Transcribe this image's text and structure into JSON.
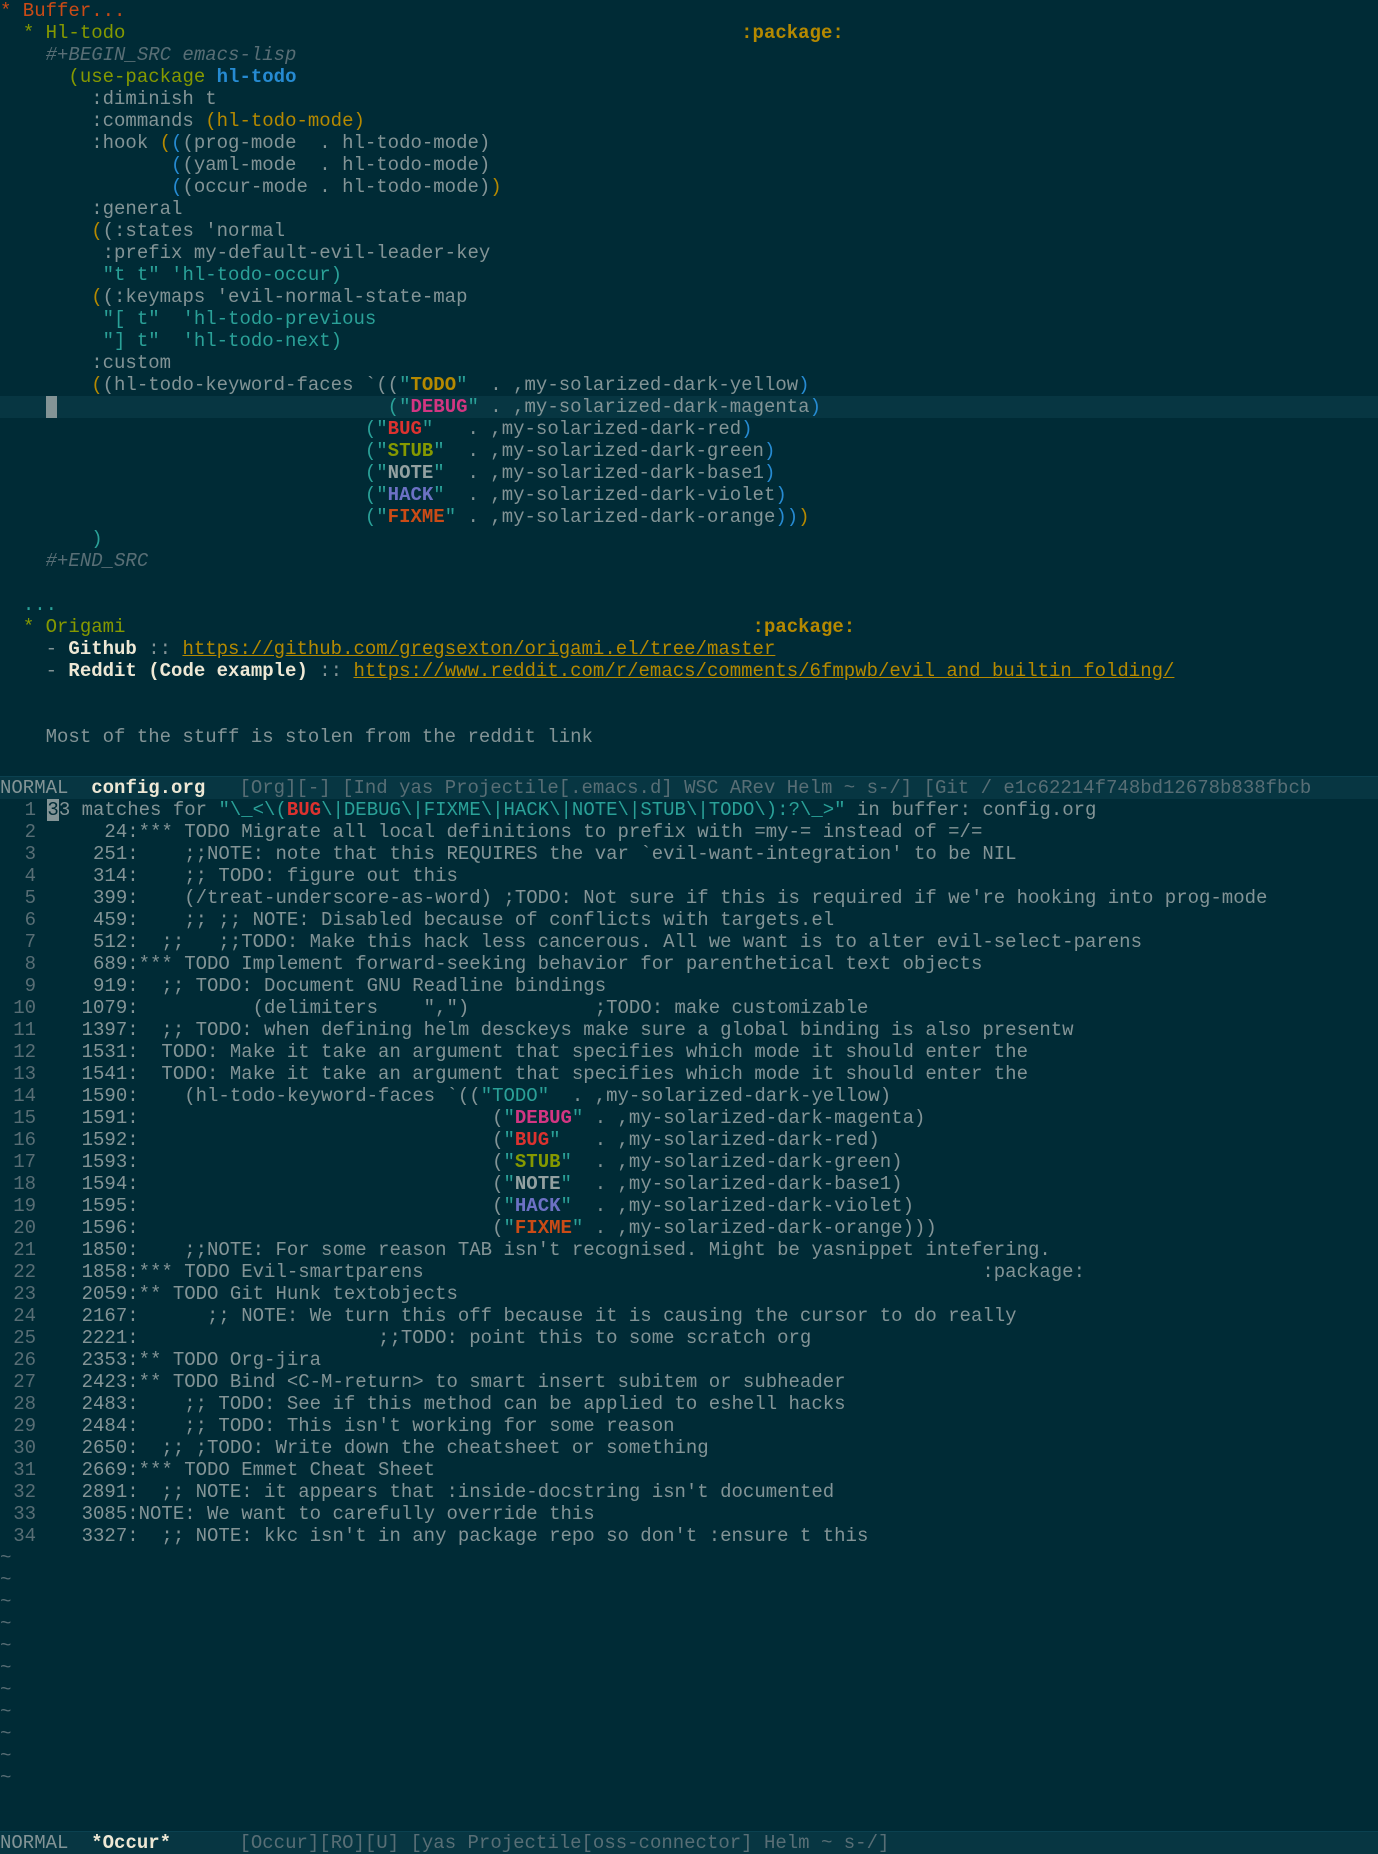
{
  "top": {
    "heading_buffer": "* Buffer...",
    "heading_hltodo": "* Hl-todo",
    "tag_package": ":package:",
    "begin_src": "#+BEGIN_SRC emacs-lisp",
    "code": {
      "l1a": "(use-package ",
      "l1b": "hl-todo",
      "l2": ":diminish t",
      "l3a": ":commands ",
      "l3b": "(hl-todo-mode)",
      "l4a": ":hook ",
      "l4b": "(prog-mode  . hl-todo-mode)",
      "l5": "(yaml-mode  . hl-todo-mode)",
      "l6": "(occur-mode . hl-todo-mode)",
      "l7": ":general",
      "l8": "(:states 'normal",
      "l9": ":prefix my-default-evil-leader-key",
      "l10": "\"t t\" 'hl-todo-occur)",
      "l11": "(:keymaps 'evil-normal-state-map",
      "l12": "\"[ t\"  'hl-todo-previous",
      "l13": "\"] t\"  'hl-todo-next)",
      "l14": ":custom",
      "l15": "(hl-todo-keyword-faces `((",
      "face_todo": "TODO",
      "face_debug": "DEBUG",
      "face_bug": "BUG",
      "face_stub": "STUB",
      "face_note": "NOTE",
      "face_hack": "HACK",
      "face_fixme": "FIXME",
      "v_yellow": ",my-solarized-dark-yellow",
      "v_magenta": ",my-solarized-dark-magenta",
      "v_red": ",my-solarized-dark-red",
      "v_green": ",my-solarized-dark-green",
      "v_base1": ",my-solarized-dark-base1",
      "v_violet": ",my-solarized-dark-violet",
      "v_orange": ",my-solarized-dark-orange",
      "close": ")"
    },
    "end_src": "#+END_SRC",
    "ellipsis": "...",
    "heading_origami": "* Origami",
    "github_label": "Github",
    "github_sep": " :: ",
    "github_url": "https://github.com/gregsexton/origami.el/tree/master",
    "reddit_label": "Reddit (Code example)",
    "reddit_url": "https://www.reddit.com/r/emacs/comments/6fmpwb/evil_and_builtin_folding/",
    "body_text": "Most of the stuff is stolen from the reddit link"
  },
  "modeline_top": {
    "state": "NORMAL",
    "buffer": "config.org",
    "rest": "   [Org][-] [Ind yas Projectile[.emacs.d] WSC ARev Helm ~ s-/] [Git / e1c62214f748bd12678b838fbcb"
  },
  "occur": {
    "header_count": "3",
    "header_rest": "3 matches for ",
    "header_regex_a": "\"\\_<\\(",
    "header_regex_bug": "BUG",
    "header_regex_b": "\\|DEBUG\\|FIXME\\|HACK\\|NOTE\\|STUB\\|TODO\\):?\\_>\"",
    "header_tail": " in buffer: config.org",
    "lines": [
      "     24:*** TODO Migrate all local definitions to prefix with =my-= instead of =/=",
      "    251:    ;;NOTE: note that this REQUIRES the var `evil-want-integration' to be NIL",
      "    314:    ;; TODO: figure out this",
      "    399:    (/treat-underscore-as-word) ;TODO: Not sure if this is required if we're hooking into prog-mode",
      "    459:    ;; ;; NOTE: Disabled because of conflicts with targets.el",
      "    512:  ;;   ;;TODO: Make this hack less cancerous. All we want is to alter evil-select-parens",
      "    689:*** TODO Implement forward-seeking behavior for parenthetical text objects",
      "    919:  ;; TODO: Document GNU Readline bindings",
      "   1079:          (delimiters    \",\")           ;TODO: make customizable",
      "   1397:  ;; TODO: when defining helm desckeys make sure a global binding is also presentw",
      "   1531:  TODO: Make it take an argument that specifies which mode it should enter the",
      "   1541:  TODO: Make it take an argument that specifies which mode it should enter the"
    ],
    "face_block_prefix": "   1590:    (hl-todo-keyword-faces `((",
    "face_block_nums": [
      "   1591:",
      "   1592:",
      "   1593:",
      "   1594:",
      "   1595:",
      "   1596:"
    ],
    "lines_after": [
      "   1850:    ;;NOTE: For some reason TAB isn't recognised. Might be yasnippet intefering.",
      "   1858:*** TODO Evil-smartparens                                                 :package:",
      "   2059:** TODO Git Hunk textobjects",
      "   2167:      ;; NOTE: We turn this off because it is causing the cursor to do really",
      "   2221:                     ;;TODO: point this to some scratch org",
      "   2353:** TODO Org-jira",
      "   2423:** TODO Bind <C-M-return> to smart insert subitem or subheader",
      "   2483:    ;; TODO: See if this method can be applied to eshell hacks",
      "   2484:    ;; TODO: This isn't working for some reason",
      "   2650:  ;; ;TODO: Write down the cheatsheet or something",
      "   2669:*** TODO Emmet Cheat Sheet",
      "   2891:  ;; NOTE: it appears that :inside-docstring isn't documented",
      "   3085:NOTE: We want to carefully override this",
      "   3327:  ;; NOTE: kkc isn't in any package repo so don't :ensure t this"
    ],
    "line_numbers": [
      "1",
      "2",
      "3",
      "4",
      "5",
      "6",
      "7",
      "8",
      "9",
      "10",
      "11",
      "12",
      "13",
      "14",
      "15",
      "16",
      "17",
      "18",
      "19",
      "20",
      "21",
      "22",
      "23",
      "24",
      "25",
      "26",
      "27",
      "28",
      "29",
      "30",
      "31",
      "32",
      "33",
      "34"
    ],
    "tilde": "~"
  },
  "modeline_bottom": {
    "state": "NORMAL",
    "buffer": "*Occur*",
    "rest": "      [Occur][RO][U] [yas Projectile[oss-connector] Helm ~ s-/]"
  },
  "colors": {
    "background": "#002b36",
    "foreground": "#839496",
    "yellow": "#b58900",
    "orange": "#cb4b16",
    "red": "#dc322f",
    "magenta": "#d33682",
    "violet": "#6c71c4",
    "blue": "#268bd2",
    "cyan": "#2aa198",
    "green": "#859900"
  }
}
